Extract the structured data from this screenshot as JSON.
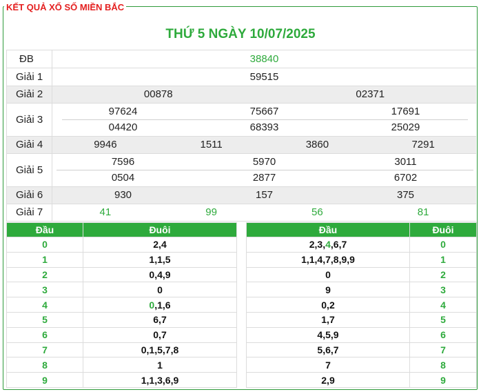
{
  "header": {
    "frame_title": "KẾT QUẢ XỔ SỐ MIỀN BẮC",
    "date_title": "THỨ 5 NGÀY 10/07/2025"
  },
  "prizes": {
    "db": {
      "label": "ĐB",
      "values": [
        "38840"
      ]
    },
    "g1": {
      "label": "Giải 1",
      "values": [
        "59515"
      ]
    },
    "g2": {
      "label": "Giải 2",
      "values": [
        "00878",
        "02371"
      ]
    },
    "g3": {
      "label": "Giải 3",
      "values": [
        "97624",
        "75667",
        "17691",
        "04420",
        "68393",
        "25029"
      ]
    },
    "g4": {
      "label": "Giải 4",
      "values": [
        "9946",
        "1511",
        "3860",
        "7291"
      ]
    },
    "g5": {
      "label": "Giải 5",
      "values": [
        "7596",
        "5970",
        "3011",
        "0504",
        "2877",
        "6702"
      ]
    },
    "g6": {
      "label": "Giải 6",
      "values": [
        "930",
        "157",
        "375"
      ]
    },
    "g7": {
      "label": "Giải 7",
      "values": [
        "41",
        "99",
        "56",
        "81"
      ]
    }
  },
  "colors": {
    "accent_green": "#2eaa3c",
    "title_red": "#e41f1f",
    "alt_row": "#ededed"
  },
  "loto_head": {
    "headers": [
      "Đầu",
      "Đuôi"
    ],
    "rows": [
      {
        "key": "0",
        "pre": "",
        "hl": "",
        "post": "2,4"
      },
      {
        "key": "1",
        "pre": "",
        "hl": "",
        "post": "1,1,5"
      },
      {
        "key": "2",
        "pre": "",
        "hl": "",
        "post": "0,4,9"
      },
      {
        "key": "3",
        "pre": "",
        "hl": "",
        "post": "0"
      },
      {
        "key": "4",
        "pre": "",
        "hl": "0",
        "post": ",1,6"
      },
      {
        "key": "5",
        "pre": "",
        "hl": "",
        "post": "6,7"
      },
      {
        "key": "6",
        "pre": "",
        "hl": "",
        "post": "0,7"
      },
      {
        "key": "7",
        "pre": "",
        "hl": "",
        "post": "0,1,5,7,8"
      },
      {
        "key": "8",
        "pre": "",
        "hl": "",
        "post": "1"
      },
      {
        "key": "9",
        "pre": "",
        "hl": "",
        "post": "1,1,3,6,9"
      }
    ]
  },
  "loto_tail": {
    "headers": [
      "Đầu",
      "Đuôi"
    ],
    "rows": [
      {
        "key": "0",
        "pre": "2,3,",
        "hl": "4",
        "post": ",6,7"
      },
      {
        "key": "1",
        "pre": "1,1,4,7,8,9,9",
        "hl": "",
        "post": ""
      },
      {
        "key": "2",
        "pre": "0",
        "hl": "",
        "post": ""
      },
      {
        "key": "3",
        "pre": "9",
        "hl": "",
        "post": ""
      },
      {
        "key": "4",
        "pre": "0,2",
        "hl": "",
        "post": ""
      },
      {
        "key": "5",
        "pre": "1,7",
        "hl": "",
        "post": ""
      },
      {
        "key": "6",
        "pre": "4,5,9",
        "hl": "",
        "post": ""
      },
      {
        "key": "7",
        "pre": "5,6,7",
        "hl": "",
        "post": ""
      },
      {
        "key": "8",
        "pre": "7",
        "hl": "",
        "post": ""
      },
      {
        "key": "9",
        "pre": "2,9",
        "hl": "",
        "post": ""
      }
    ]
  }
}
